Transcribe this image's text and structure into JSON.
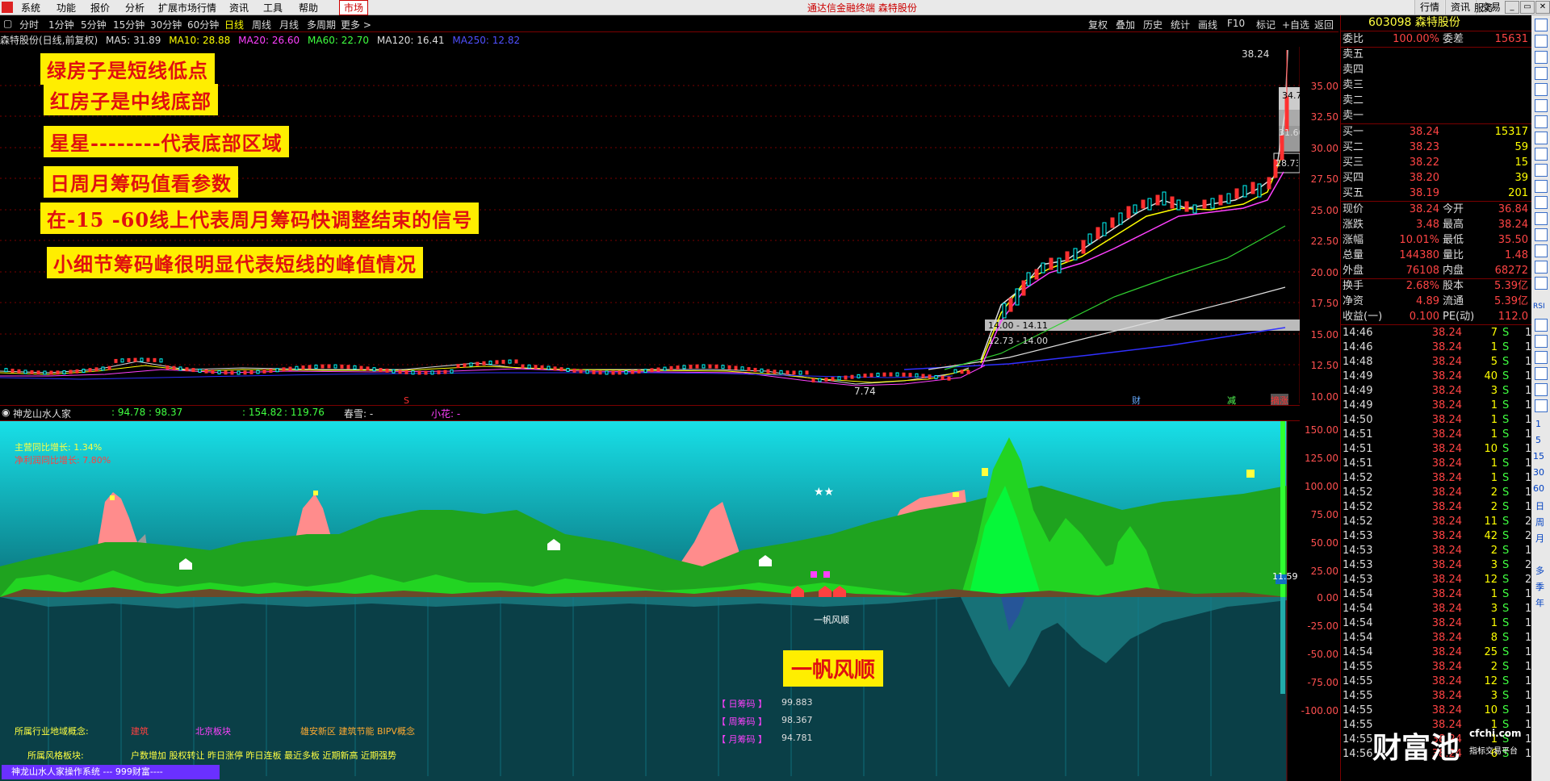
{
  "menubar": {
    "items": [
      "系统",
      "功能",
      "报价",
      "分析",
      "扩展市场行情",
      "资讯",
      "工具",
      "帮助",
      "市场"
    ],
    "title": "通达信金融终端 森特股份",
    "right_buttons": [
      "行情",
      "资讯",
      "交易",
      "服务"
    ],
    "window_buttons": [
      "_",
      "▭",
      "✕"
    ]
  },
  "periodbar": {
    "items": [
      "分时",
      "1分钟",
      "5分钟",
      "15分钟",
      "30分钟",
      "60分钟",
      "日线",
      "周线",
      "月线",
      "多周期",
      "更多 >"
    ],
    "selected": "日线",
    "tools": [
      "复权",
      "叠加",
      "历史",
      "统计",
      "画线",
      "F10",
      "标记",
      "+自选",
      "返回"
    ]
  },
  "maline": {
    "stock": "森特股份(日线,前复权)",
    "ma5": "MA5: 31.89",
    "ma10": "MA10: 28.88",
    "ma20": "MA20: 26.60",
    "ma60": "MA60: 22.70",
    "ma120": "MA120: 16.41",
    "ma250": "MA250: 12.82"
  },
  "annotations": [
    "绿房子是短线低点",
    "红房子是中线底部",
    "星星--------代表底部区域",
    "日周月筹码值看参数",
    "在-15      -60线上代表周月筹码快调整结束的信号",
    "小细节筹码峰很明显代表短线的峰值情况"
  ],
  "main_axis": [
    "35.00",
    "32.50",
    "30.00",
    "27.50",
    "25.00",
    "22.50",
    "20.00",
    "17.50",
    "15.00",
    "12.50",
    "10.00"
  ],
  "price_labels": {
    "high": "38.24",
    "low": "7.74",
    "box1": "34.7",
    "box2": "31.60",
    "box3": "28.73",
    "range1": "14.00 - 14.11",
    "range2": "12.73 - 14.00"
  },
  "event_marks": [
    "S",
    "财",
    "减",
    "摘涨"
  ],
  "indicator_header": {
    "name": "神龙山水人家",
    "v1": ": 94.78",
    "v2": ": 98.37",
    "v3": ": 154.82",
    "v4": ": 119.76",
    "label_a": "春雪: -",
    "label_b": "小花: -"
  },
  "indicator": {
    "growth1": "主营同比增长: 1.34%",
    "growth2": "净利润同比增长: 7.80%",
    "axis": [
      "150.00",
      "125.00",
      "100.00",
      "75.00",
      "50.00",
      "25.00",
      "0.00",
      "-25.00",
      "-50.00",
      "-75.00",
      "-100.00"
    ],
    "current": "11.59",
    "stars": "★★",
    "banner": "一帆风顺",
    "small_caption": "一帆风顺",
    "chips": [
      {
        "label": "【 日筹码 】",
        "value": "99.883"
      },
      {
        "label": "【 周筹码 】",
        "value": "98.367"
      },
      {
        "label": "【 月筹码 】",
        "value": "94.781"
      }
    ],
    "industry_label": "所属行业地域概念:",
    "industry_values": [
      "建筑",
      "北京板块",
      "雄安新区 建筑节能 BIPV概念"
    ],
    "style_label": "所属风格板块:",
    "style_value": "户数增加 股权转让 昨日涨停 昨日连板 最近多板 近期新高 近期强势",
    "bottom_bar": "神龙山水人家操作系统 --- 999财富----"
  },
  "quote": {
    "code_name": "603098 森特股份",
    "weibi_label": "委比",
    "weibi": "100.00%",
    "weicha_label": "委差",
    "weicha": "15631",
    "sells": [
      "卖五",
      "卖四",
      "卖三",
      "卖二",
      "卖一"
    ],
    "buys": [
      {
        "label": "买一",
        "price": "38.24",
        "vol": "15317"
      },
      {
        "label": "买二",
        "price": "38.23",
        "vol": "59"
      },
      {
        "label": "买三",
        "price": "38.22",
        "vol": "15"
      },
      {
        "label": "买四",
        "price": "38.20",
        "vol": "39"
      },
      {
        "label": "买五",
        "price": "38.19",
        "vol": "201"
      }
    ],
    "stats": [
      {
        "l1": "现价",
        "v1": "38.24",
        "l2": "今开",
        "v2": "36.84"
      },
      {
        "l1": "涨跌",
        "v1": "3.48",
        "l2": "最高",
        "v2": "38.24"
      },
      {
        "l1": "涨幅",
        "v1": "10.01%",
        "l2": "最低",
        "v2": "35.50"
      },
      {
        "l1": "总量",
        "v1": "144380",
        "l2": "量比",
        "v2": "1.48"
      },
      {
        "l1": "外盘",
        "v1": "76108",
        "l2": "内盘",
        "v2": "68272"
      },
      {
        "l1": "换手",
        "v1": "2.68%",
        "l2": "股本",
        "v2": "5.39亿"
      },
      {
        "l1": "净资",
        "v1": "4.89",
        "l2": "流通",
        "v2": "5.39亿"
      },
      {
        "l1": "收益(一)",
        "v1": "0.100",
        "l2": "PE(动)",
        "v2": "112.0"
      }
    ],
    "ticks": [
      [
        "14:46",
        "38.24",
        "7",
        "S",
        "1"
      ],
      [
        "14:46",
        "38.24",
        "1",
        "S",
        "1"
      ],
      [
        "14:48",
        "38.24",
        "5",
        "S",
        "1"
      ],
      [
        "14:49",
        "38.24",
        "40",
        "S",
        "1"
      ],
      [
        "14:49",
        "38.24",
        "3",
        "S",
        "1"
      ],
      [
        "14:49",
        "38.24",
        "1",
        "S",
        "1"
      ],
      [
        "14:50",
        "38.24",
        "1",
        "S",
        "1"
      ],
      [
        "14:51",
        "38.24",
        "1",
        "S",
        "1"
      ],
      [
        "14:51",
        "38.24",
        "10",
        "S",
        "1"
      ],
      [
        "14:51",
        "38.24",
        "1",
        "S",
        "1"
      ],
      [
        "14:52",
        "38.24",
        "1",
        "S",
        "1"
      ],
      [
        "14:52",
        "38.24",
        "2",
        "S",
        "1"
      ],
      [
        "14:52",
        "38.24",
        "2",
        "S",
        "1"
      ],
      [
        "14:52",
        "38.24",
        "11",
        "S",
        "2"
      ],
      [
        "14:53",
        "38.24",
        "42",
        "S",
        "2"
      ],
      [
        "14:53",
        "38.24",
        "2",
        "S",
        "1"
      ],
      [
        "14:53",
        "38.24",
        "3",
        "S",
        "2"
      ],
      [
        "14:53",
        "38.24",
        "12",
        "S",
        "2"
      ],
      [
        "14:54",
        "38.24",
        "1",
        "S",
        "1"
      ],
      [
        "14:54",
        "38.24",
        "3",
        "S",
        "1"
      ],
      [
        "14:54",
        "38.24",
        "1",
        "S",
        "1"
      ],
      [
        "14:54",
        "38.24",
        "8",
        "S",
        "1"
      ],
      [
        "14:54",
        "38.24",
        "25",
        "S",
        "1"
      ],
      [
        "14:55",
        "38.24",
        "2",
        "S",
        "1"
      ],
      [
        "14:55",
        "38.24",
        "12",
        "S",
        "1"
      ],
      [
        "14:55",
        "38.24",
        "3",
        "S",
        "1"
      ],
      [
        "14:55",
        "38.24",
        "10",
        "S",
        "1"
      ],
      [
        "14:55",
        "38.24",
        "1",
        "S",
        "1"
      ],
      [
        "14:55",
        "38.24",
        "1",
        "S",
        "1"
      ],
      [
        "14:56",
        "38.24",
        "6",
        "S",
        "1"
      ]
    ]
  },
  "watermark": {
    "big": "财富池",
    "small1": "cfchi.com",
    "small2": "指标交易平台"
  },
  "sidetools_text": [
    "RSI",
    "1",
    "5",
    "15",
    "30",
    "60",
    "日",
    "周",
    "月",
    "多",
    "季",
    "年"
  ]
}
